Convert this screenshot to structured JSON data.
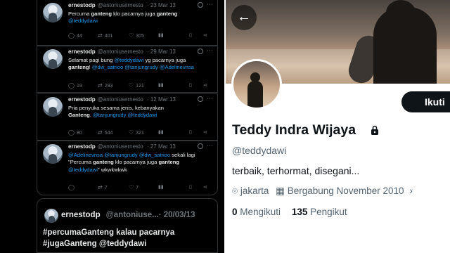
{
  "left": {
    "tweets": [
      {
        "name": "ernestodp",
        "handle": "@antoniusernesto",
        "date": "· 23 Mar 13",
        "parts": [
          "Percuma ",
          "ganteng",
          " klo pacarnya juga ",
          "ganteng"
        ],
        "line2": "@teddydawi",
        "replies": "44",
        "retweets": "401",
        "likes": "305"
      },
      {
        "name": "ernestodp",
        "handle": "@antoniusernesto",
        "date": "· 29 Mar 13",
        "l1a": "Selamat pagi bung ",
        "l1m": "@teddydawi",
        "l1b": " yg pacarnya juga",
        "l2a": "ganteng",
        "l2b": "! ",
        "l2m": "@dw_satrioo @tanjungrudy @Adelinevnsa",
        "replies": "19",
        "retweets": "293",
        "likes": "121"
      },
      {
        "name": "ernestodp",
        "handle": "@antoniusernesto",
        "date": "· 12 Mar 13",
        "l1": "Pria penyuka sesama jenis, kebanyakan",
        "l2a": "Ganteng",
        "l2b": ". ",
        "l2m": "@tanjungrudy @teddydawi",
        "replies": "80",
        "retweets": "544",
        "likes": "321"
      },
      {
        "name": "ernestodp",
        "handle": "@antoniusernesto",
        "date": "· 27 Mar 13",
        "l1m": "@Adelinevnsa @tanjungrudy @dw_satrioo",
        "l1b": " sekali lagi",
        "l2a": "\"Percuma ",
        "l2b": "ganteng",
        "l2c": " klo pacarnya juga ",
        "l2d": "ganteng",
        "l3m": "@teddydawi",
        "l3b": "\" wkwkwkwk",
        "replies": "",
        "retweets": "7",
        "likes": "7"
      }
    ],
    "big": {
      "name": "ernestodp",
      "handle": "@antoniuse...",
      "date": "· 20/03/13",
      "line1": "#percumaGanteng kalau pacarnya",
      "line2": "#jugaGanteng @teddydawi"
    },
    "icons": [
      "reply-icon",
      "retweet-icon",
      "like-icon",
      "views-icon",
      "bookmark-icon",
      "share-icon"
    ]
  },
  "profile": {
    "back_symbol": "←",
    "follow_label": "Ikuti",
    "name": "Teddy Indra Wijaya",
    "handle": "@teddydawi",
    "bio": "terbaik, terhormat, disegani...",
    "location": "jakarta",
    "joined": "Bergabung November 2010",
    "following_count": "0",
    "following_label": "Mengikuti",
    "followers_count": "135",
    "followers_label": "Pengikut"
  }
}
